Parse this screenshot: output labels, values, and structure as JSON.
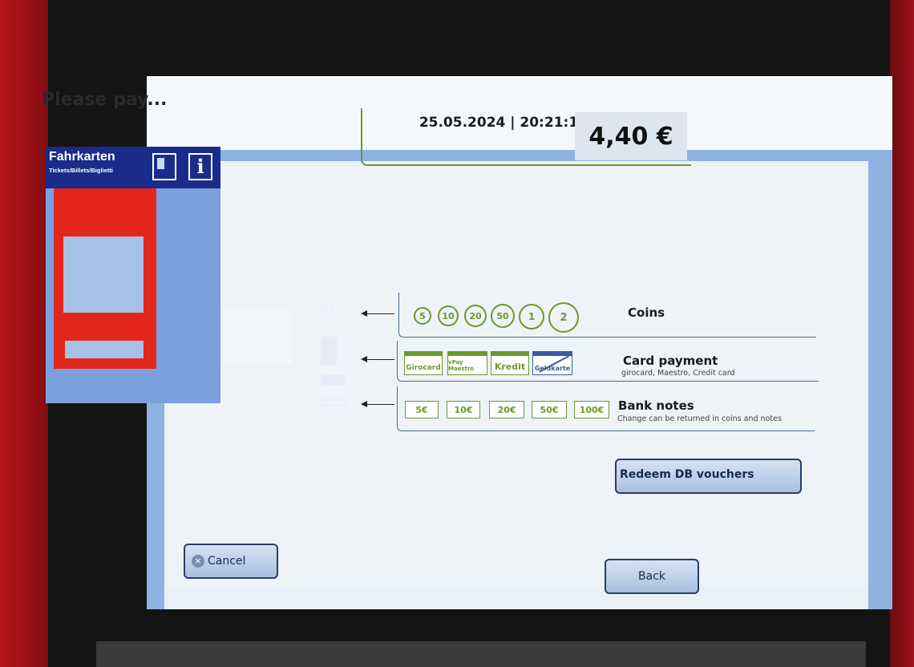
{
  "header": {
    "datetime": "25.05.2024 | 20:21:11 Uhr"
  },
  "page": {
    "title": "Please pay..."
  },
  "amount": {
    "value": "4,40 €"
  },
  "machine": {
    "title": "Fahrkarten",
    "subtitle": "Tickets/Billets/Biglietti",
    "info_glyph": "i",
    "coin_glyph": "i"
  },
  "payment": {
    "coins": {
      "label": "Coins",
      "items": [
        "5",
        "10",
        "20",
        "50",
        "1",
        "2"
      ]
    },
    "cards": {
      "label": "Card payment",
      "subtitle": "girocard, Maestro, Credit card",
      "items": [
        "Girocard",
        "vPay Maestro",
        "Kredit",
        "Geldkarte"
      ]
    },
    "notes": {
      "label": "Bank notes",
      "subtitle": "Change can be returned in coins and notes",
      "items": [
        "5€",
        "10€",
        "20€",
        "50€",
        "100€"
      ]
    }
  },
  "buttons": {
    "voucher": "Redeem DB vouchers",
    "cancel": "Cancel",
    "cancel_glyph": "×",
    "back": "Back"
  },
  "colors": {
    "screen_bg": "#e9f0f7",
    "accent_blue": "#8fb3e0",
    "accent_green": "#6a9a2c",
    "machine_red": "#e3261c",
    "machine_navy": "#1a2b8a"
  },
  "icons": [
    "device-icon",
    "info-icon",
    "coin-slot-icon",
    "card-reader-icon",
    "note-slot-icon",
    "arrow-left-icon",
    "close-icon"
  ]
}
